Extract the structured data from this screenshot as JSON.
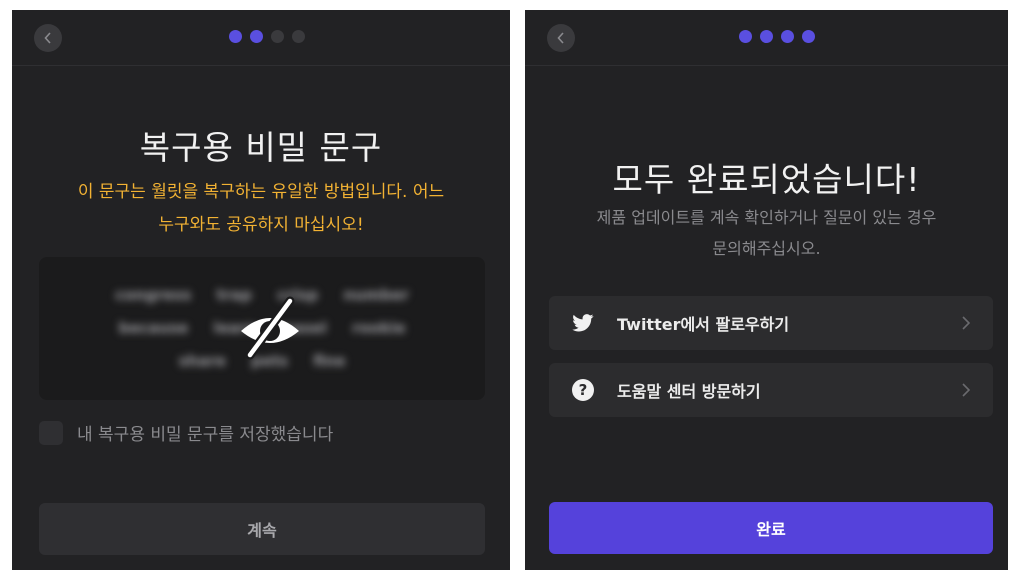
{
  "left": {
    "title": "복구용 비밀 문구",
    "warning_line1": "이 문구는 월릿을 복구하는 유일한 방법입니다. 어느",
    "warning_line2": "누구와도 공유하지 마십시오!",
    "hidden_words": [
      "congress",
      "trap",
      "crisp",
      "number",
      "because",
      "learn",
      "easel",
      "rookie",
      "share",
      "pets",
      "fine"
    ],
    "checkbox_label": "내 복구용 비밀 문구를 저장했습니다",
    "continue_label": "계속",
    "progress": {
      "current": 2,
      "total": 4
    }
  },
  "right": {
    "title": "모두 완료되었습니다!",
    "subtitle_line1": "제품 업데이트를 계속 확인하거나 질문이 있는 경우",
    "subtitle_line2": "문의해주십시오.",
    "items": [
      {
        "label": "Twitter에서 팔로우하기",
        "icon": "twitter-icon"
      },
      {
        "label": "도움말 센터 방문하기",
        "icon": "help-icon"
      }
    ],
    "done_label": "완료",
    "progress": {
      "current": 4,
      "total": 4
    }
  },
  "colors": {
    "accent": "#5542db",
    "warning": "#f2b233",
    "panel_bg": "#222224"
  }
}
